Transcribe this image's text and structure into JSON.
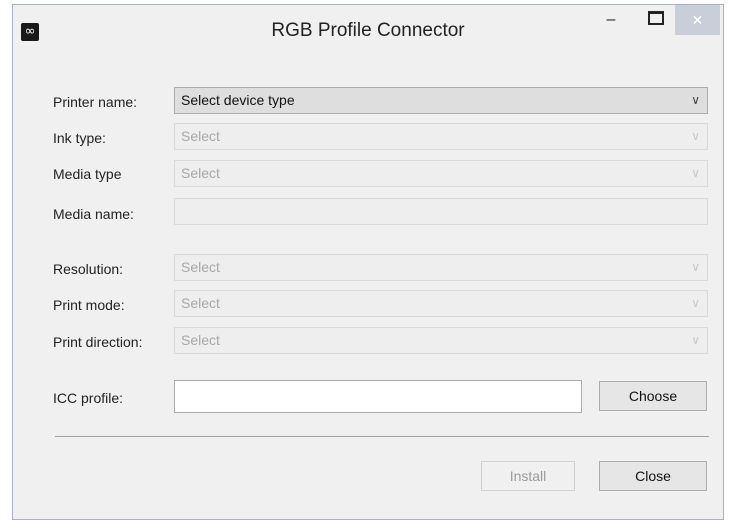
{
  "window": {
    "app_icon": "∞",
    "title": "RGB Profile Connector",
    "minimize": "–",
    "close": "✕"
  },
  "form": {
    "printer_name": {
      "label": "Printer name:",
      "value": "Select device type"
    },
    "ink_type": {
      "label": "Ink type:",
      "value": "Select"
    },
    "media_type": {
      "label": "Media type",
      "value": "Select"
    },
    "media_name": {
      "label": "Media name:",
      "value": ""
    },
    "resolution": {
      "label": "Resolution:",
      "value": "Select"
    },
    "print_mode": {
      "label": "Print mode:",
      "value": "Select"
    },
    "print_direction": {
      "label": "Print direction:",
      "value": "Select"
    },
    "icc_profile": {
      "label": "ICC profile:",
      "value": ""
    }
  },
  "buttons": {
    "choose": "Choose",
    "install": "Install",
    "close": "Close"
  },
  "icons": {
    "dropdown": "chevron-down-icon",
    "app": "app-logo-icon"
  }
}
